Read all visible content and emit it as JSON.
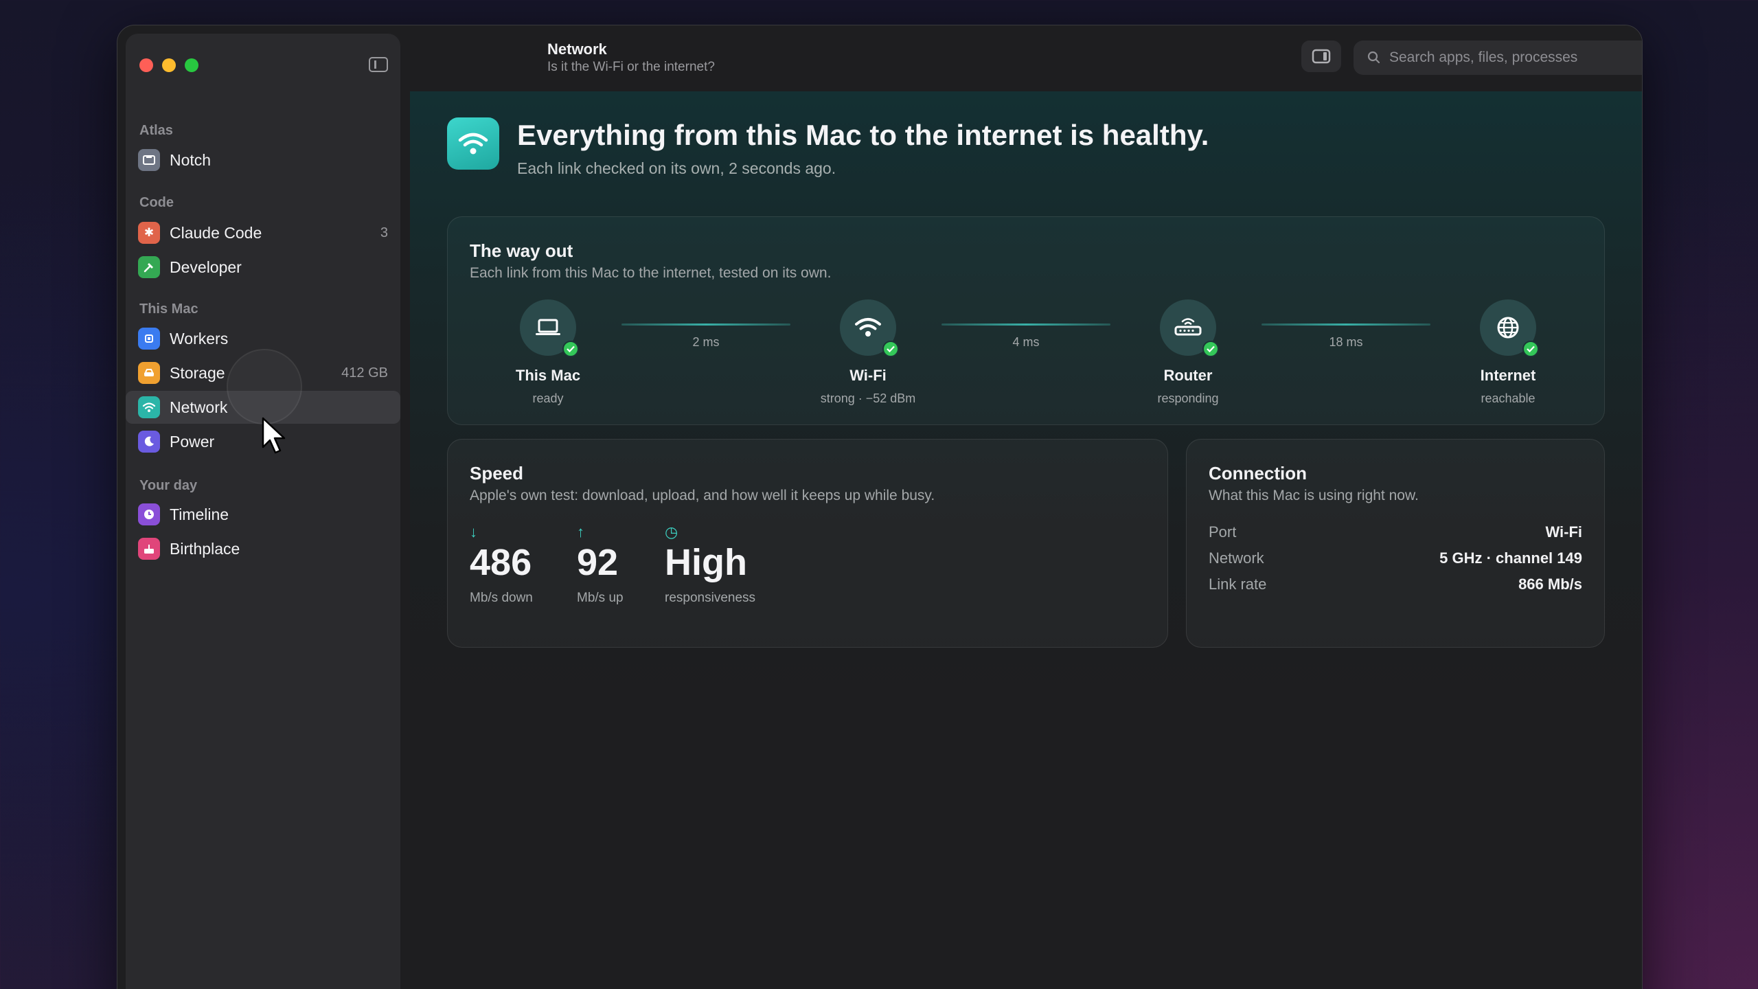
{
  "sidebar": {
    "sections": [
      {
        "title": "Atlas"
      },
      {
        "title": "Code"
      },
      {
        "title": "This Mac"
      },
      {
        "title": "Your day"
      }
    ],
    "items": [
      {
        "label": "Notch",
        "icon": "notch-icon"
      },
      {
        "label": "Claude Code",
        "icon": "asterisk-icon",
        "count": "3"
      },
      {
        "label": "Developer",
        "icon": "hammer-icon"
      },
      {
        "label": "Workers",
        "icon": "cpu-icon"
      },
      {
        "label": "Storage",
        "icon": "drive-icon",
        "count": "412 GB"
      },
      {
        "label": "Network",
        "icon": "wifi-icon"
      },
      {
        "label": "Power",
        "icon": "moon-icon"
      },
      {
        "label": "Timeline",
        "icon": "clock-icon"
      },
      {
        "label": "Birthplace",
        "icon": "cake-icon"
      }
    ]
  },
  "header": {
    "title": "Network",
    "subtitle": "Is it the Wi-Fi or the internet?",
    "search_placeholder": "Search apps, files, processes"
  },
  "hero": {
    "title": "Everything from this Mac to the internet is healthy.",
    "subtitle": "Each link checked on its own, 2 seconds ago."
  },
  "way_out": {
    "title": "The way out",
    "subtitle": "Each link from this Mac to the internet, tested on its own.",
    "nodes": [
      {
        "name": "This Mac",
        "status": "ready"
      },
      {
        "name": "Wi-Fi",
        "status": "strong · −52 dBm"
      },
      {
        "name": "Router",
        "status": "responding"
      },
      {
        "name": "Internet",
        "status": "reachable"
      }
    ],
    "links": [
      "2 ms",
      "4 ms",
      "18 ms"
    ]
  },
  "speed": {
    "title": "Speed",
    "subtitle": "Apple's own test: download, upload, and how well it keeps up while busy.",
    "metrics": [
      {
        "arrow": "↓",
        "value": "486",
        "unit": "Mb/s down"
      },
      {
        "arrow": "↑",
        "value": "92",
        "unit": "Mb/s up"
      },
      {
        "arrow": "◷",
        "value": "High",
        "unit": "responsiveness"
      }
    ]
  },
  "connection": {
    "title": "Connection",
    "subtitle": "What this Mac is using right now.",
    "rows": [
      {
        "key": "Port",
        "value": "Wi-Fi"
      },
      {
        "key": "Network",
        "value": "5 GHz · channel 149"
      },
      {
        "key": "Link rate",
        "value": "866 Mb/s"
      }
    ]
  },
  "colors": {
    "accent": "#3ccfc0",
    "ok": "#34c759"
  }
}
